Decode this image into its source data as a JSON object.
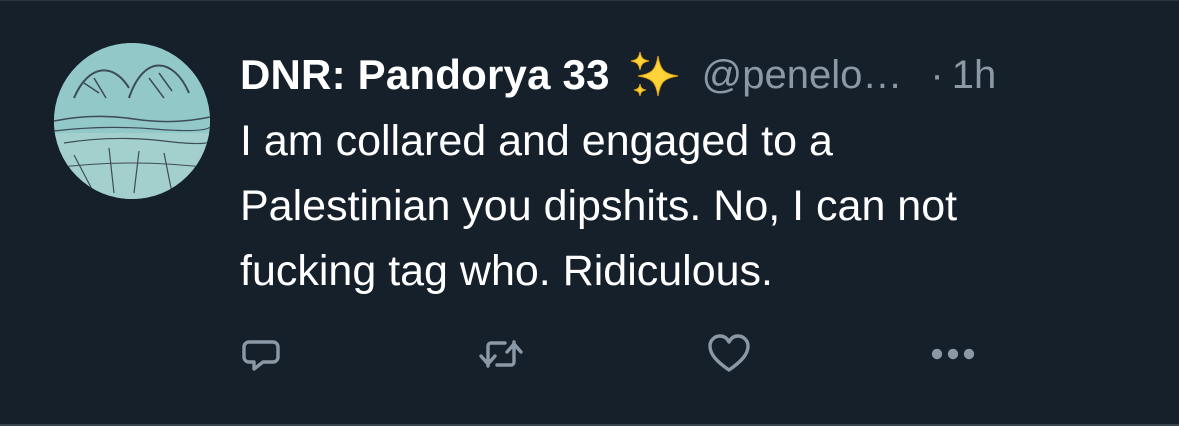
{
  "tweet": {
    "display_name": "DNR: Pandorya 33",
    "emoji_icon": "sparkles-icon",
    "handle": "@penelo…",
    "separator": "·",
    "time": "1h",
    "body_lines": [
      "I am collared and engaged to a",
      "Palestinian you dipshits. No, I can not",
      "fucking tag who. Ridiculous."
    ]
  },
  "actions": [
    {
      "icon": "reply-icon"
    },
    {
      "icon": "retweet-icon"
    },
    {
      "icon": "like-icon"
    },
    {
      "icon": "more-icon"
    }
  ],
  "colors": {
    "background": "#15202b",
    "text_primary": "#ffffff",
    "text_secondary": "#8b98a5",
    "icon": "#8b98a5",
    "sparkle": "#ffd43b"
  }
}
